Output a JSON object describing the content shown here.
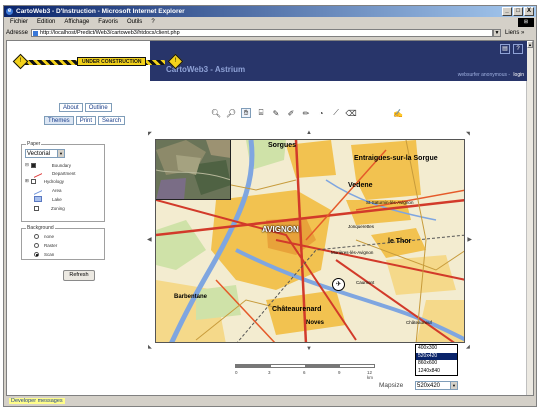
{
  "window": {
    "title": "CartoWeb3 - D'Instruction - Microsoft Internet Explorer",
    "controls": [
      "_",
      "□",
      "X"
    ]
  },
  "menubar": {
    "items": [
      "Fichier",
      "Edition",
      "Affichage",
      "Favoris",
      "Outils",
      "?"
    ]
  },
  "addressbar": {
    "label": "Adresse",
    "url": "http://localhost/Predict/Web3/cartoweb3/htdocs/client.php",
    "links": "Liens »"
  },
  "banner": {
    "construction_label": "UNDER CONSTRUCTION",
    "app_title": "CartoWeb3 - Astrium",
    "user_text": "websurfer anonymous -",
    "logout": "login",
    "icons": [
      "pdf-icon",
      "help-icon"
    ]
  },
  "nav": {
    "row1": [
      "About",
      "Outline"
    ],
    "row2": [
      "Themes",
      "Print",
      "Search"
    ]
  },
  "layers_panel": {
    "legend": "Paper",
    "selected": "Vectorial",
    "layers": [
      {
        "label": "Boundary",
        "checked": true
      },
      {
        "label": "Department",
        "checked": false
      },
      {
        "label": "Hydrology",
        "checked": false
      },
      {
        "label": "Area",
        "checked": false
      },
      {
        "label": "Lake",
        "checked": false
      },
      {
        "label": "Zoning",
        "checked": false
      }
    ]
  },
  "background_panel": {
    "legend": "Background",
    "options": [
      {
        "label": "none",
        "selected": false
      },
      {
        "label": "Raster",
        "selected": false
      },
      {
        "label": "Scan",
        "selected": true
      }
    ]
  },
  "refresh_label": "Refresh",
  "tools": [
    "zoom-in-icon",
    "zoom-out-icon",
    "pan-icon",
    "query-icon",
    "pencil-point-icon",
    "pencil-line-icon",
    "pencil-polygon-icon",
    "measure-area-icon",
    "measure-distance-icon",
    "clear-icon"
  ],
  "map": {
    "labels": {
      "sorgues": "Sorgues",
      "entraigues": "Entraigues-sur-la Sorgue",
      "vedene": "Vedene",
      "avignon": "AVIGNON",
      "lethor": "le Thor",
      "chateaurenard": "Châteaurenard",
      "barbentane": "Barbentane",
      "noves": "Noves",
      "jonquerettes": "Jonquerettes",
      "saturnin": "St-Saturnin-lès-Avignon",
      "morieres": "Morières-lès-Avignon",
      "caumont": "Caumont",
      "chateauneuf": "Châteauneuf"
    }
  },
  "scale": {
    "ticks": [
      "0",
      "3",
      "6",
      "9",
      "12 km"
    ]
  },
  "mapsize": {
    "label": "Mapsize",
    "options": [
      "400x300",
      "520x420",
      "860x600",
      "1240x840"
    ],
    "highlighted": "520x420",
    "selected": "520x420"
  },
  "developer_messages": "Developer messages"
}
